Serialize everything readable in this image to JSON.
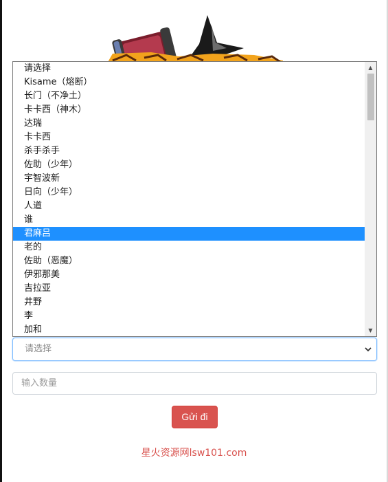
{
  "logo": {
    "alt": "game-logo"
  },
  "dropdown": {
    "options": [
      "请选择",
      "Kisame（熔断）",
      "长门（不净土）",
      "卡卡西（神木）",
      "达瑞",
      "卡卡西",
      "杀手杀手",
      "佐助（少年）",
      "宇智波新",
      "日向（少年）",
      "人道",
      "谁",
      "君麻吕",
      "老的",
      "佐助（恶魔）",
      "伊邪那美",
      "吉拉亚",
      "井野",
      "李",
      "加和"
    ],
    "highlighted_option": "君麻吕"
  },
  "select": {
    "value": "请选择"
  },
  "quantity": {
    "placeholder": "输入数量"
  },
  "submit": {
    "label": "Gửi đi"
  },
  "footer": {
    "link_text": "星火资源网lsw101.com"
  },
  "colors": {
    "highlight": "#1e90ff",
    "button": "#d9534f",
    "focus_border": "#80bdff"
  }
}
